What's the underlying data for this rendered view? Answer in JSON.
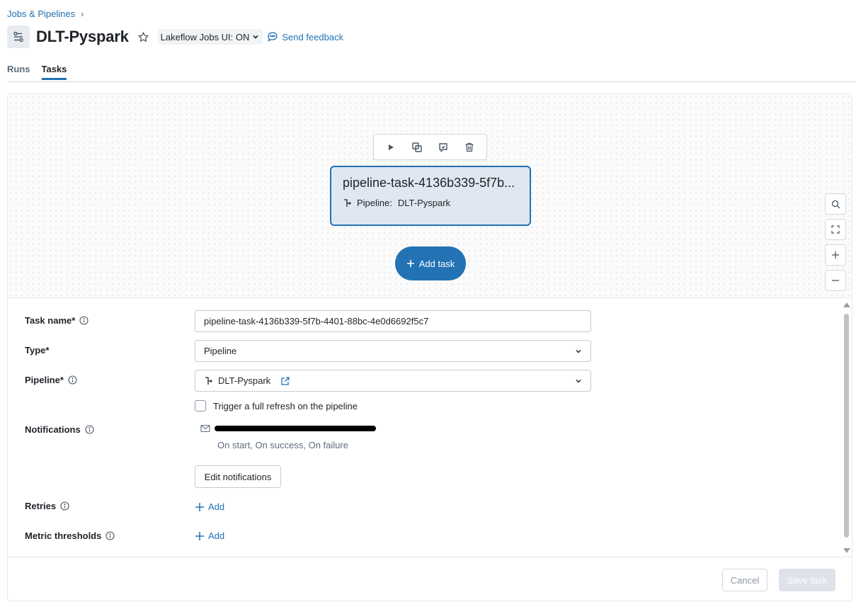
{
  "breadcrumb": {
    "parent": "Jobs & Pipelines",
    "separator": "›"
  },
  "header": {
    "title": "DLT-Pyspark",
    "ui_toggle_label": "Lakeflow Jobs UI: ON",
    "feedback_label": "Send feedback"
  },
  "tabs": [
    {
      "label": "Runs",
      "active": false
    },
    {
      "label": "Tasks",
      "active": true
    }
  ],
  "canvas": {
    "node": {
      "title": "pipeline-task-4136b339-5f7b...",
      "sub_label": "Pipeline:",
      "sub_value": "DLT-Pyspark"
    },
    "toolbar_icons": [
      "play-icon",
      "duplicate-icon",
      "run-repair-icon",
      "trash-icon"
    ],
    "add_task_label": "Add task",
    "zoom_controls": [
      "search-icon",
      "fit-view-icon",
      "zoom-in-icon",
      "zoom-out-icon"
    ]
  },
  "form": {
    "task_name_label": "Task name*",
    "task_name_value": "pipeline-task-4136b339-5f7b-4401-88bc-4e0d6692f5c7",
    "type_label": "Type*",
    "type_value": "Pipeline",
    "pipeline_label": "Pipeline*",
    "pipeline_value": "DLT-Pyspark",
    "full_refresh_label": "Trigger a full refresh on the pipeline",
    "full_refresh_checked": false,
    "notifications_label": "Notifications",
    "notification_events": "On start, On success, On failure",
    "edit_notifications_label": "Edit notifications",
    "retries_label": "Retries",
    "retries_add_label": "Add",
    "metric_thresholds_label": "Metric thresholds",
    "metric_add_label": "Add"
  },
  "footer": {
    "cancel_label": "Cancel",
    "save_label": "Save task"
  },
  "colors": {
    "accent": "#2272b4",
    "node_bg": "#dfe8f1",
    "muted_text": "#5f6b7a"
  }
}
